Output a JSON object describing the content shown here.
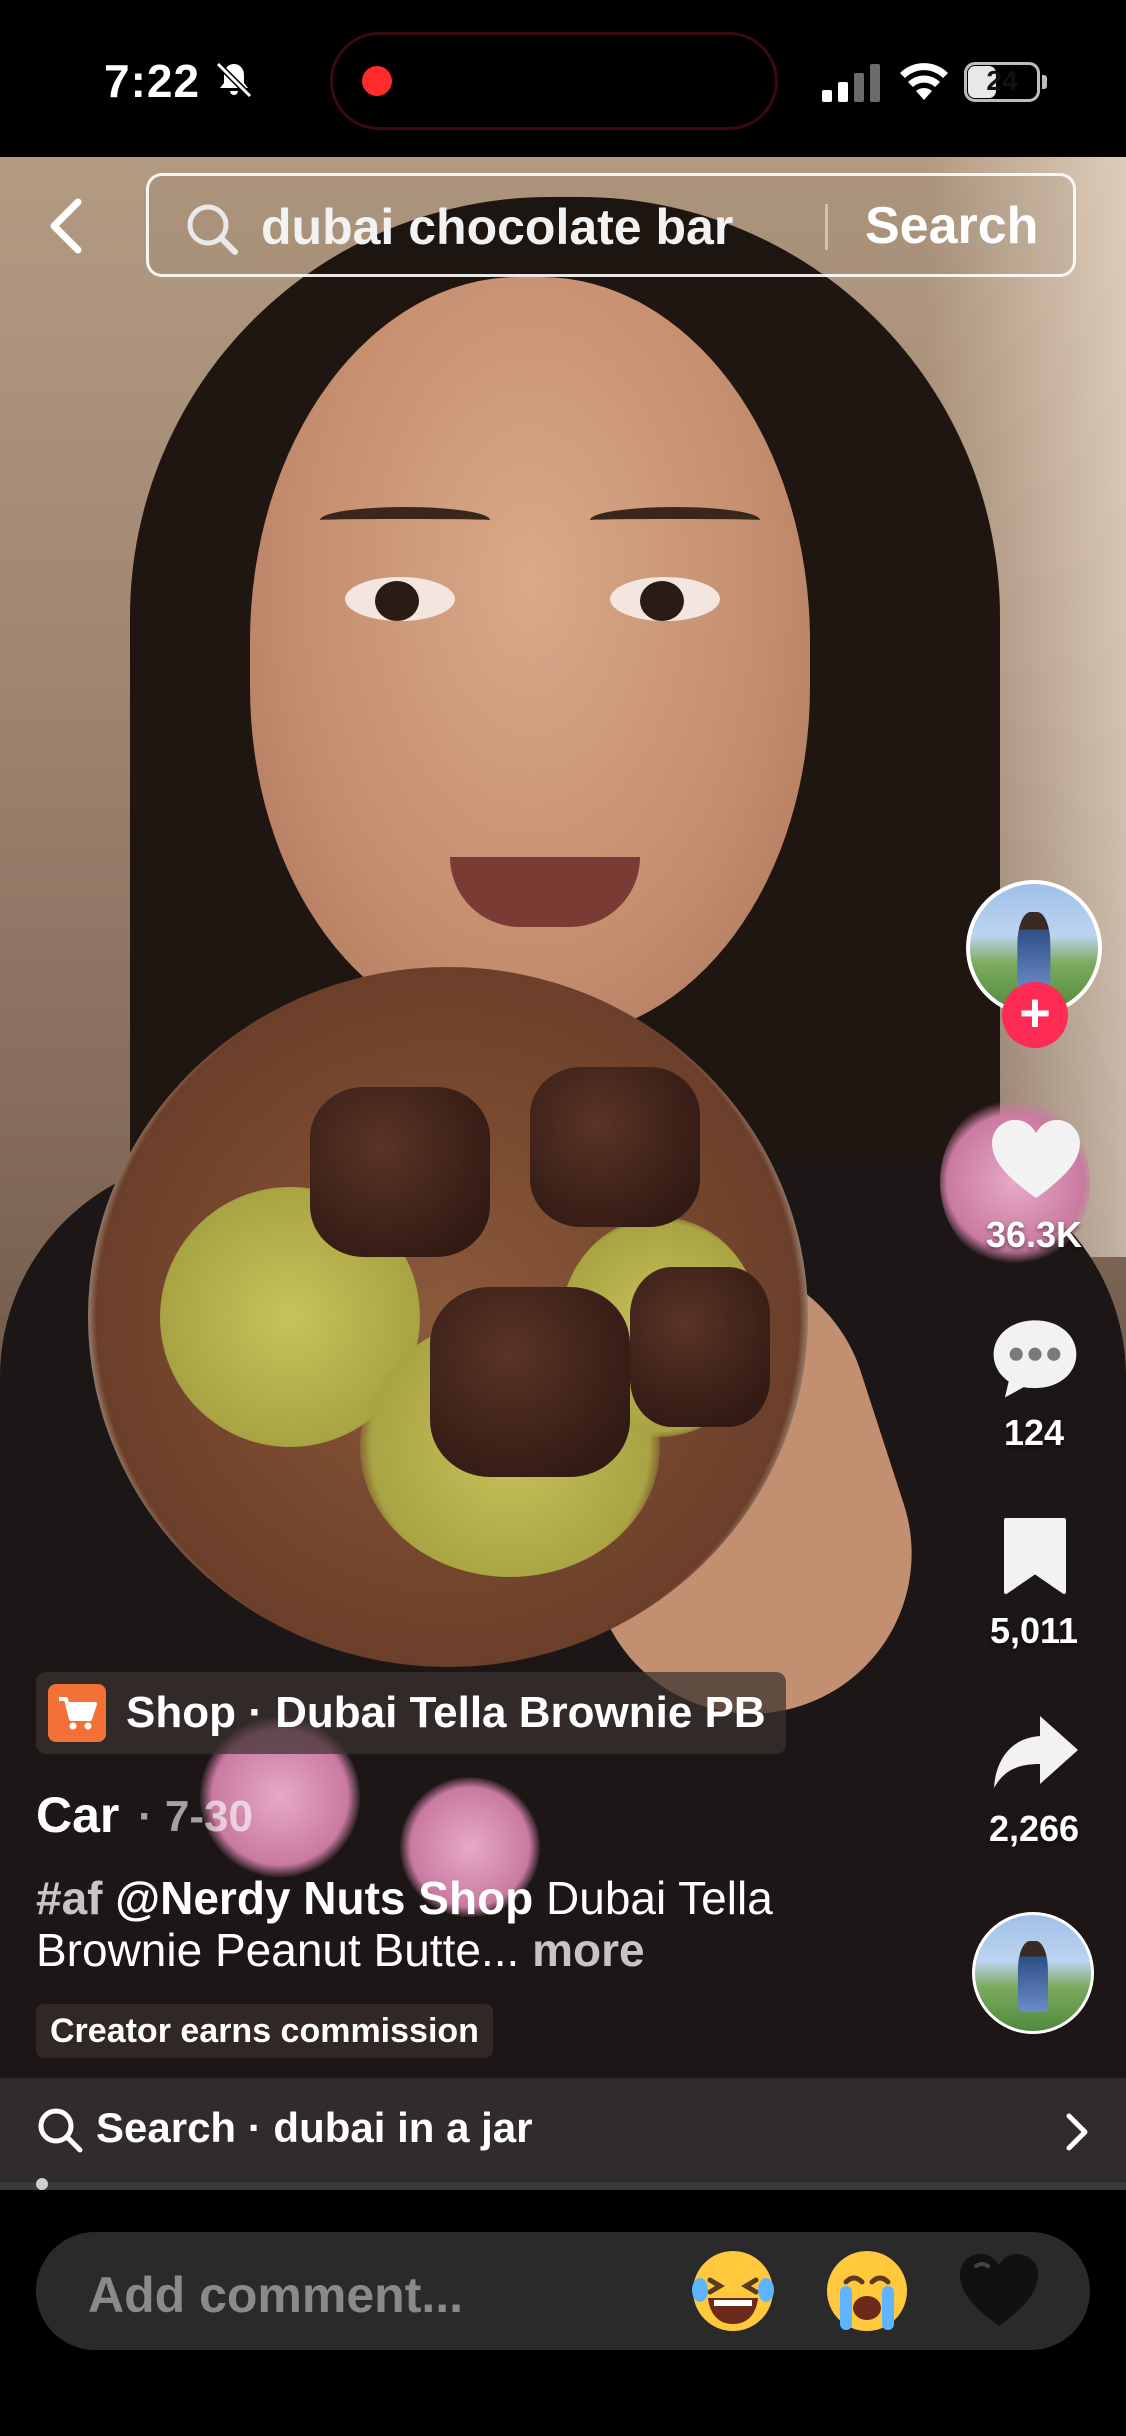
{
  "status_bar": {
    "time": "7:22",
    "battery": "24",
    "colors": {
      "recording_dot": "#ff2a2a"
    }
  },
  "search": {
    "query": "dubai chocolate bar",
    "button_label": "Search"
  },
  "actions": {
    "likes": "36.3K",
    "comments": "124",
    "saves": "5,011",
    "shares": "2,266",
    "follow_symbol": "+"
  },
  "shop": {
    "label": "Shop · Dubai Tella Brownie PB"
  },
  "post": {
    "author": "Car",
    "date": "· 7-30",
    "caption_hashtag": "#af",
    "caption_mention": "@Nerdy Nuts Shop",
    "caption_text": "Dubai Tella Brownie Peanut Butte...",
    "more_label": "more",
    "commission_badge": "Creator earns commission"
  },
  "related_search": {
    "label": "Search · dubai in a jar"
  },
  "comment_bar": {
    "placeholder": "Add comment...",
    "emoji_1": "😂",
    "emoji_2": "😭",
    "emoji_3": "🖤"
  },
  "icons": [
    "back-chevron-icon",
    "search-icon",
    "heart-icon",
    "comment-icon",
    "bookmark-icon",
    "share-icon",
    "cart-icon",
    "chevron-right-icon",
    "bell-slash-icon",
    "signal-icon",
    "wifi-icon",
    "battery-icon"
  ],
  "colors": {
    "follow_plus": "#fe2c55",
    "shop_badge": "#f37036"
  }
}
